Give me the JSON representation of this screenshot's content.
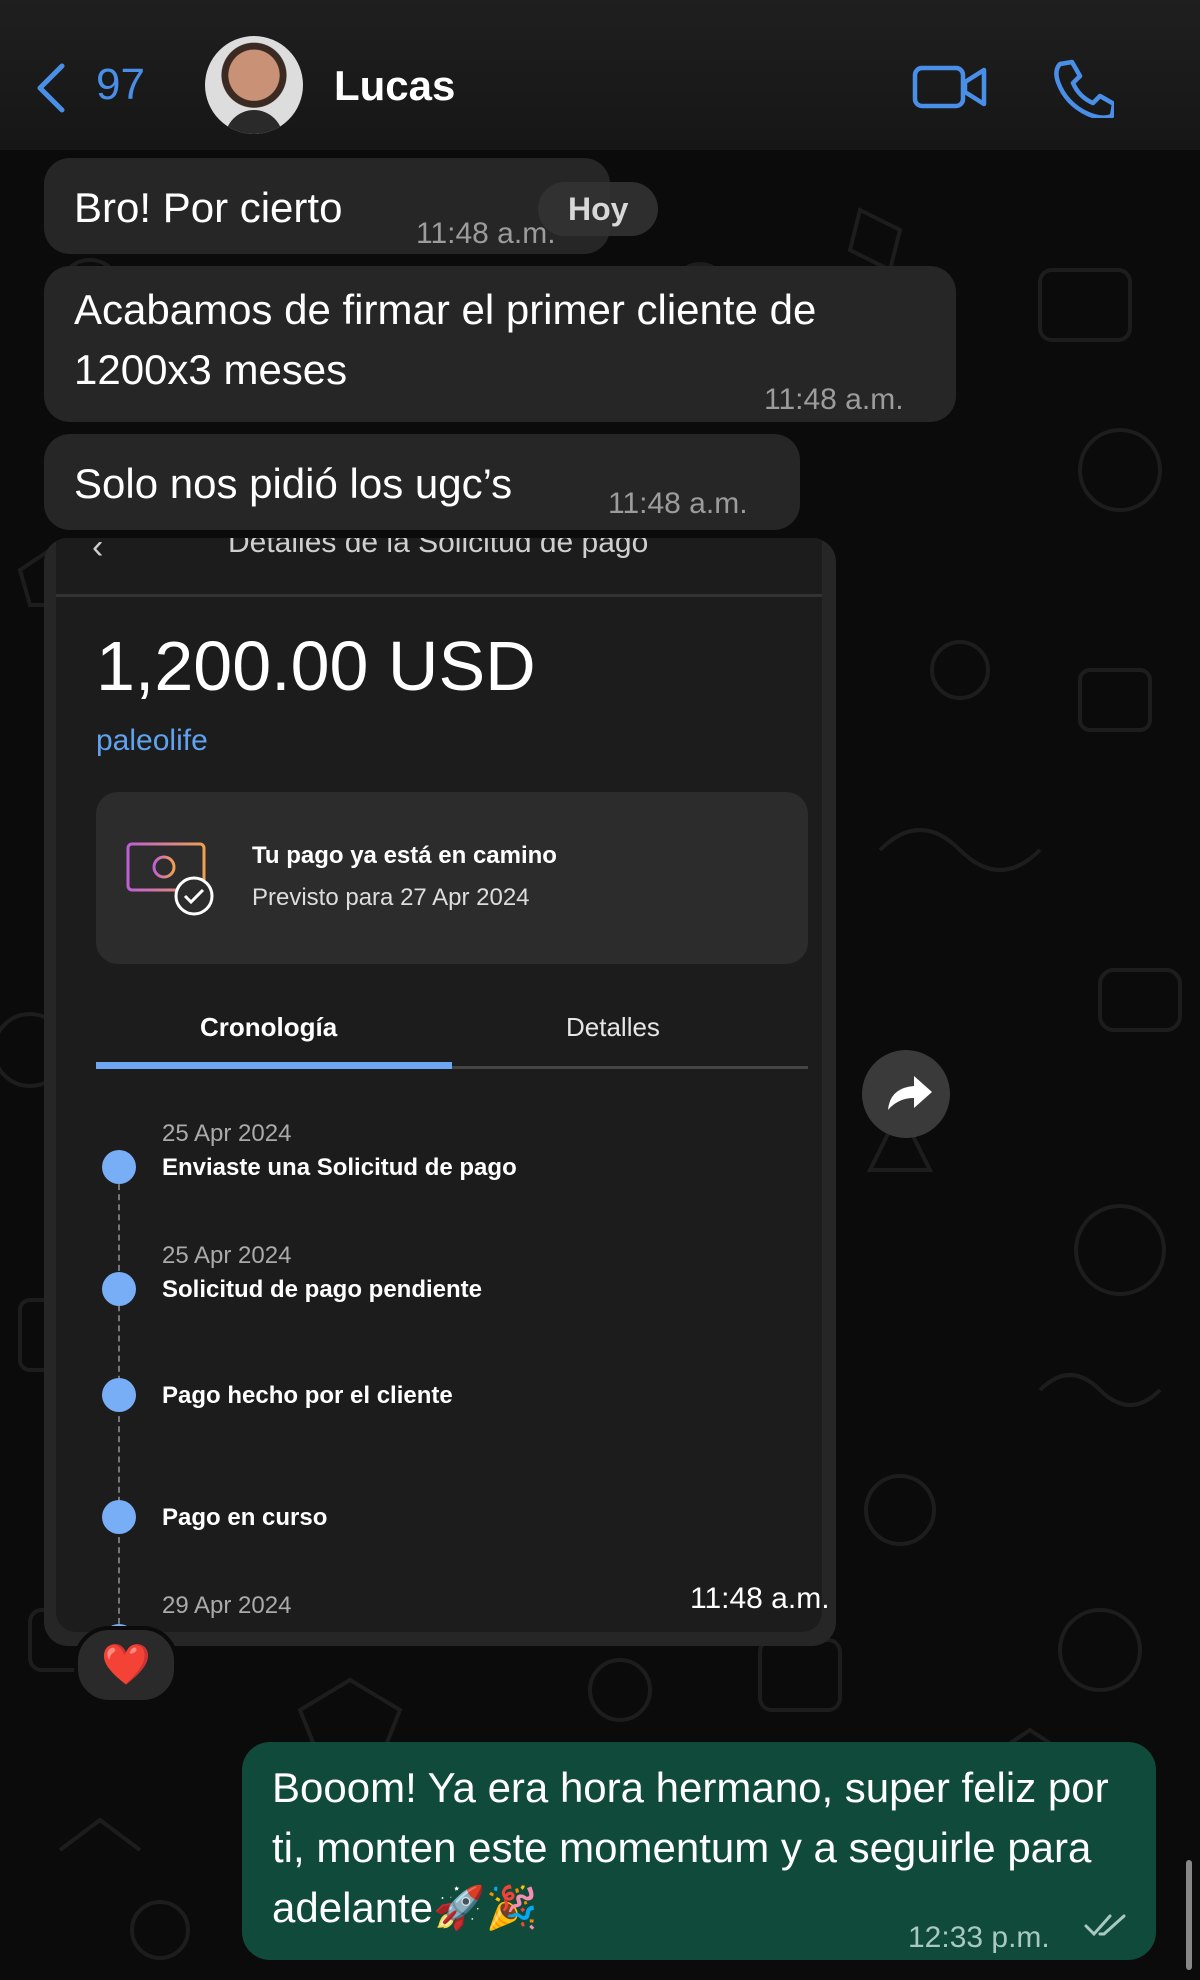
{
  "header": {
    "back_count": "97",
    "contact_name": "Lucas"
  },
  "day_chip": "Hoy",
  "messages_in": [
    {
      "text": "Bro! Por cierto",
      "time": "11:48 a.m."
    },
    {
      "text": "Acabamos de firmar el primer cliente de 1200x3 meses",
      "time": "11:48 a.m."
    },
    {
      "text": "Solo nos pidió los ugc’s",
      "time": "11:48 a.m."
    }
  ],
  "image_message": {
    "time": "11:48 a.m.",
    "screenshot": {
      "title": "Detalles de la Solicitud de pago",
      "amount": "1,200.00 USD",
      "merchant": "paleolife",
      "status_title": "Tu pago ya está en camino",
      "status_sub": "Previsto para 27 Apr 2024",
      "tabs": [
        "Cronología",
        "Detalles"
      ],
      "timeline": [
        {
          "date": "25 Apr 2024",
          "label": "Enviaste una Solicitud de pago"
        },
        {
          "date": "25 Apr 2024",
          "label": "Solicitud de pago pendiente"
        },
        {
          "date": "",
          "label": "Pago hecho por el cliente"
        },
        {
          "date": "",
          "label": "Pago en curso"
        },
        {
          "date": "29 Apr 2024",
          "label": ""
        }
      ]
    },
    "reaction": "❤️"
  },
  "message_out": {
    "text": "Booom! Ya era hora hermano, super feliz por ti, monten este momentum y a seguirle para adelante🚀🎉",
    "time": "12:33 p.m."
  },
  "colors": {
    "accent": "#4a8fe7",
    "incoming_bubble": "#262626",
    "outgoing_bubble": "#0f4a3a",
    "timeline_dot": "#78aef5"
  }
}
